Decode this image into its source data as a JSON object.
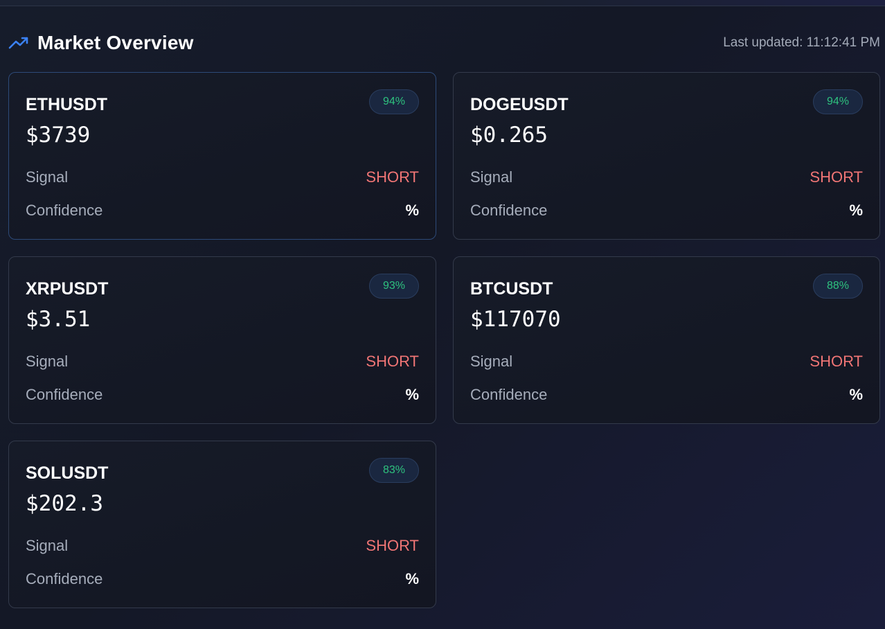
{
  "header": {
    "title": "Market Overview",
    "last_updated": "Last updated: 11:12:41 PM"
  },
  "labels": {
    "signal": "Signal",
    "confidence": "Confidence"
  },
  "colors": {
    "accent": "#3b82f6",
    "badge_text": "#2ec27e",
    "short": "#f07575"
  },
  "cards": [
    {
      "symbol": "ETHUSDT",
      "price": "$3739",
      "badge": "94%",
      "signal": "SHORT",
      "confidence": "%"
    },
    {
      "symbol": "DOGEUSDT",
      "price": "$0.265",
      "badge": "94%",
      "signal": "SHORT",
      "confidence": "%"
    },
    {
      "symbol": "XRPUSDT",
      "price": "$3.51",
      "badge": "93%",
      "signal": "SHORT",
      "confidence": "%"
    },
    {
      "symbol": "BTCUSDT",
      "price": "$117070",
      "badge": "88%",
      "signal": "SHORT",
      "confidence": "%"
    },
    {
      "symbol": "SOLUSDT",
      "price": "$202.3",
      "badge": "83%",
      "signal": "SHORT",
      "confidence": "%"
    }
  ]
}
